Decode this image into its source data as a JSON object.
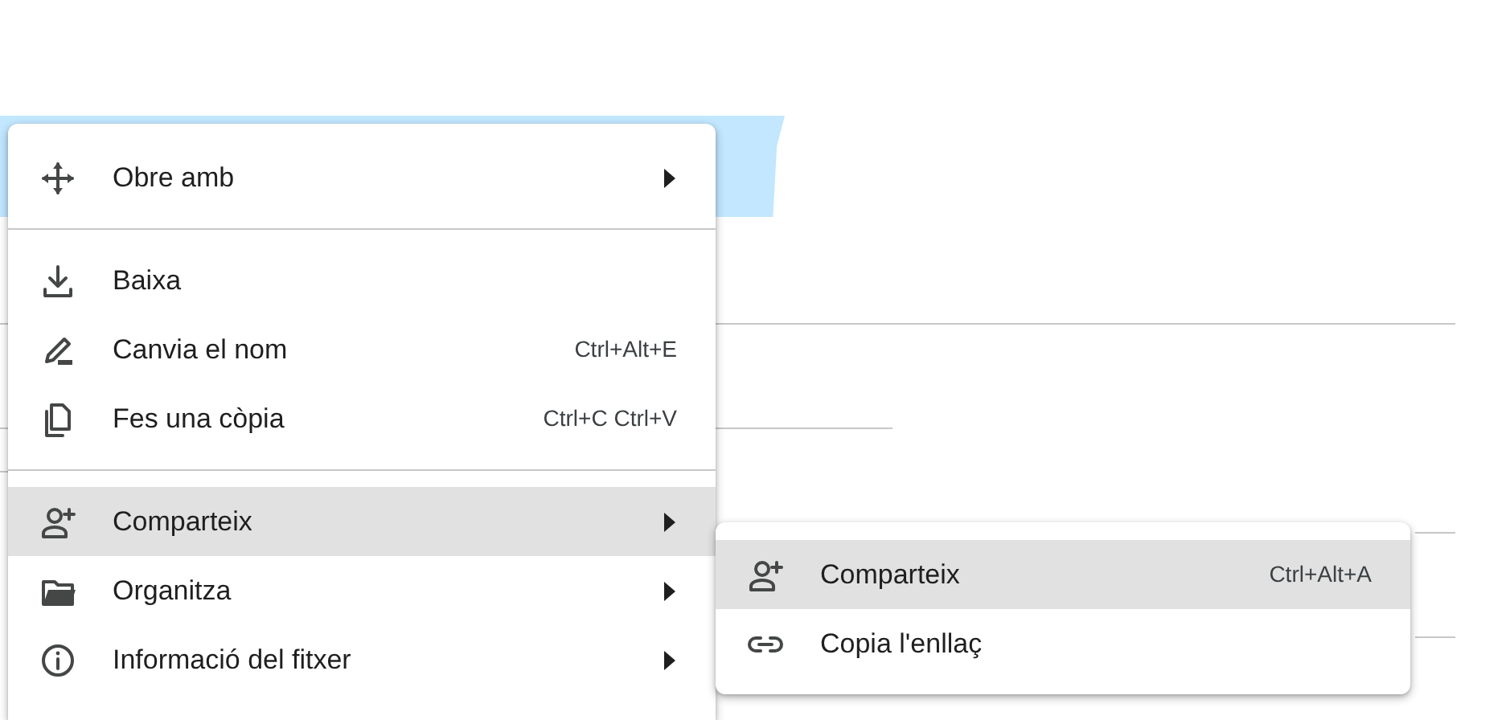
{
  "menu": {
    "items": [
      {
        "kind": "item",
        "label": "Obre amb",
        "has_submenu": true,
        "selected": false
      },
      {
        "kind": "divider"
      },
      {
        "kind": "item",
        "label": "Baixa",
        "has_submenu": false,
        "selected": false
      },
      {
        "kind": "item",
        "label": "Canvia el nom",
        "shortcut": "Ctrl+Alt+E",
        "has_submenu": false,
        "selected": false
      },
      {
        "kind": "item",
        "label": "Fes una còpia",
        "shortcut": "Ctrl+C Ctrl+V",
        "has_submenu": false,
        "selected": false
      },
      {
        "kind": "divider"
      },
      {
        "kind": "item",
        "label": "Comparteix",
        "has_submenu": true,
        "selected": true
      },
      {
        "kind": "item",
        "label": "Organitza",
        "has_submenu": true,
        "selected": false
      },
      {
        "kind": "item",
        "label": "Informació del fitxer",
        "has_submenu": true,
        "selected": false
      }
    ]
  },
  "submenu": {
    "items": [
      {
        "kind": "item",
        "label": "Comparteix",
        "shortcut": "Ctrl+Alt+A",
        "selected": true
      },
      {
        "kind": "item",
        "label": "Copia l'enllaç",
        "selected": false
      }
    ]
  }
}
